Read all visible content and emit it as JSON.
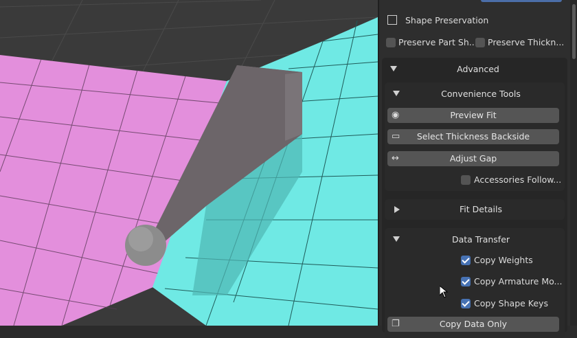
{
  "shape_preservation": {
    "title": "Shape Preservation",
    "preserve_part_label": "Preserve Part Sh...",
    "preserve_thickness_label": "Preserve Thickn..."
  },
  "advanced": {
    "title": "Advanced",
    "convenience_tools": {
      "title": "Convenience Tools",
      "preview_fit_label": "Preview Fit",
      "select_thickness_label": "Select Thickness Backside",
      "adjust_gap_label": "Adjust Gap",
      "accessories_follow_label": "Accessories Follow..."
    },
    "fit_details": {
      "title": "Fit Details"
    },
    "data_transfer": {
      "title": "Data Transfer",
      "copy_weights_label": "Copy Weights",
      "copy_armature_label": "Copy Armature Mo...",
      "copy_shape_keys_label": "Copy Shape Keys",
      "copy_data_only_label": "Copy Data Only"
    }
  },
  "colors": {
    "pink_plane": "#e38fdc",
    "cyan_plane": "#6fe9e4",
    "accent": "#4772b3"
  }
}
